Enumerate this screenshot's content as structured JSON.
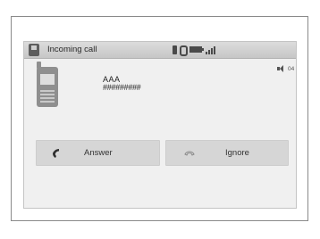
{
  "header": {
    "title": "Incoming call",
    "status_icons": [
      "bluetooth-icon",
      "device-0-icon",
      "battery-icon",
      "signal-icon"
    ]
  },
  "volume": {
    "value": "04"
  },
  "caller": {
    "name": "AAA",
    "number": "#########"
  },
  "actions": {
    "answer_label": "Answer",
    "ignore_label": "Ignore"
  }
}
